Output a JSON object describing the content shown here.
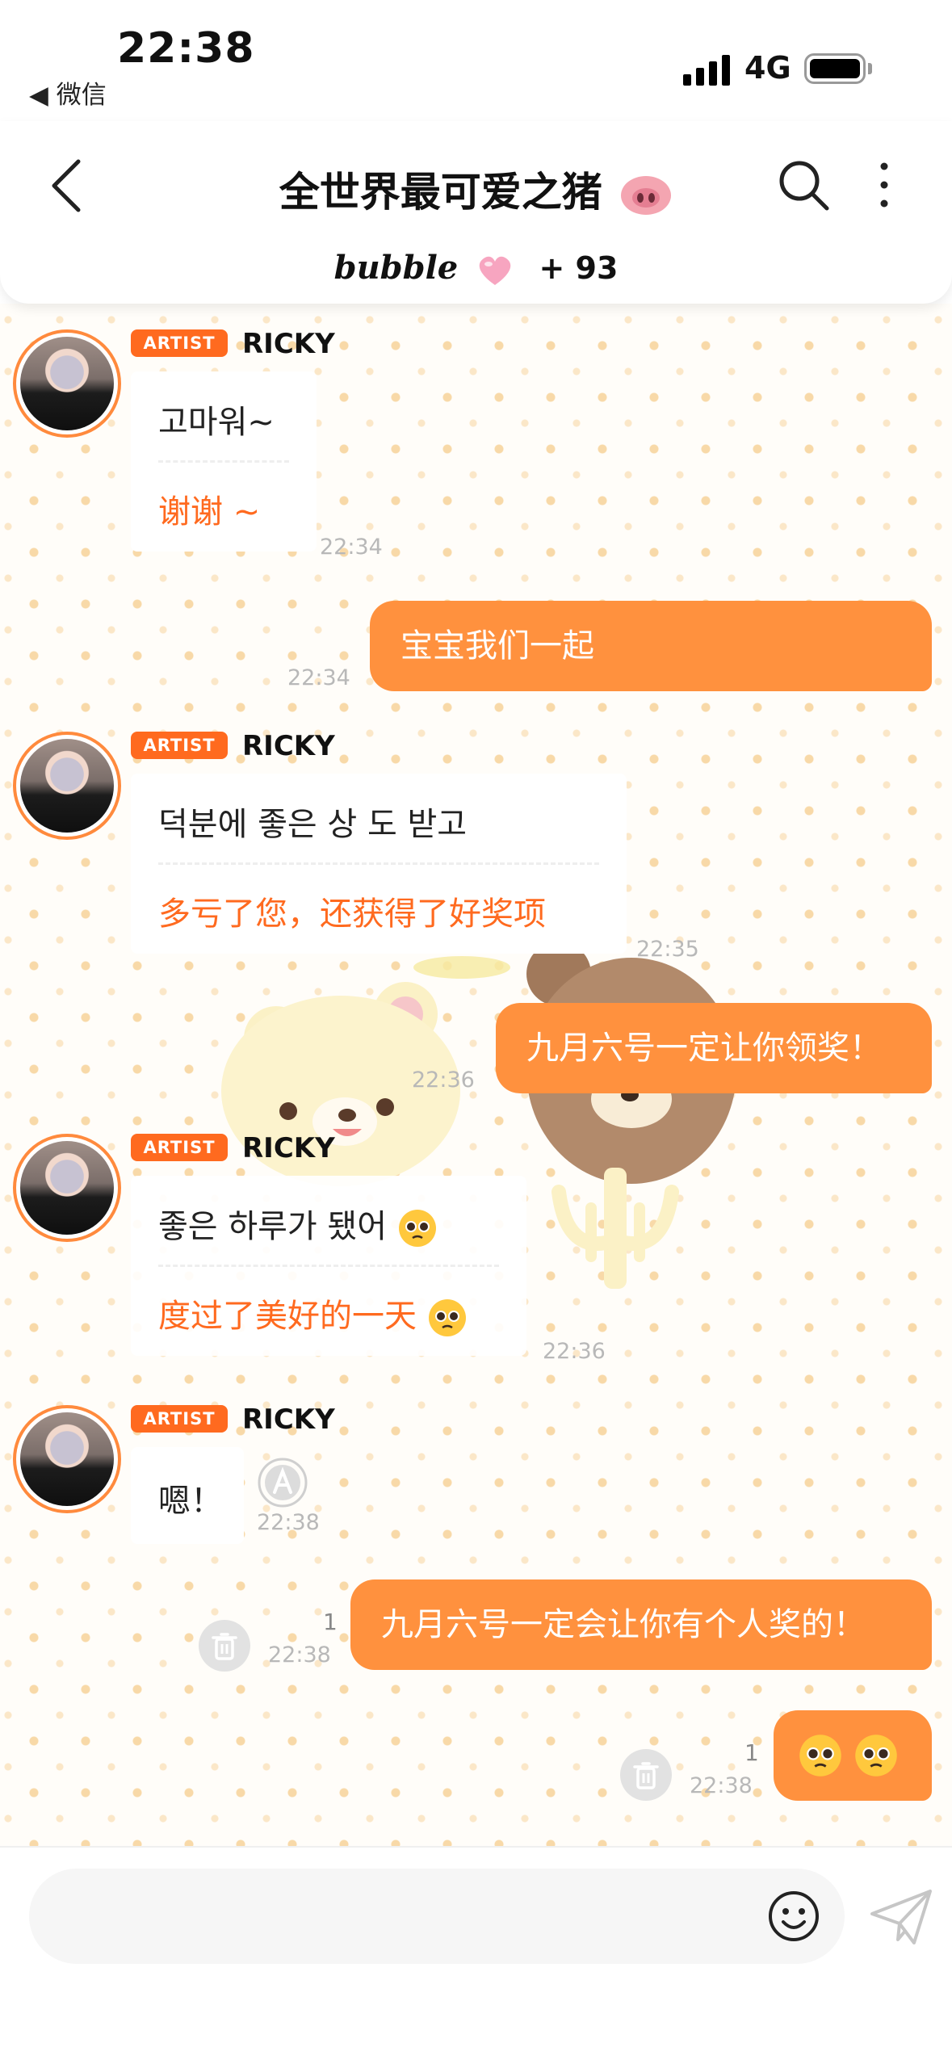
{
  "status_bar": {
    "time": "22:38",
    "back_app": "◀ 微信",
    "network": "4G"
  },
  "header": {
    "title": "全世界最可爱之猪",
    "bubble_logo": "bubble",
    "bubble_count": "+ 93"
  },
  "messages": {
    "m1": {
      "badge": "ARTIST",
      "sender": "RICKY",
      "original": "고마워~",
      "translation": "谢谢 ~",
      "time": "22:34"
    },
    "m2": {
      "text": "宝宝我们一起",
      "time": "22:34"
    },
    "m3": {
      "badge": "ARTIST",
      "sender": "RICKY",
      "original": "덕분에 좋은 상 도 받고",
      "translation": "多亏了您，还获得了好奖项",
      "time": "22:35"
    },
    "m4": {
      "text": "九月六号一定让你领奖！",
      "time": "22:36"
    },
    "m5": {
      "badge": "ARTIST",
      "sender": "RICKY",
      "original": "좋은 하루가 됐어",
      "translation": "度过了美好的一天",
      "time": "22:36"
    },
    "m6": {
      "badge": "ARTIST",
      "sender": "RICKY",
      "text": "嗯！",
      "time": "22:38"
    },
    "m7": {
      "text": "九月六号一定会让你有个人奖的！",
      "time": "22:38",
      "unread": "1"
    },
    "m8": {
      "time": "22:38",
      "unread": "1"
    }
  },
  "composer": {
    "placeholder": ""
  },
  "colors": {
    "accent": "#ff6a1f",
    "sent_bubble": "#ff913e",
    "pattern_dot": "#f8d9a8"
  },
  "icons": [
    "back-icon",
    "search-icon",
    "more-icon",
    "heart-icon",
    "pig-emoji",
    "pleading-face-emoji",
    "translate-icon",
    "trash-icon",
    "smiley-icon",
    "paper-plane-icon"
  ]
}
